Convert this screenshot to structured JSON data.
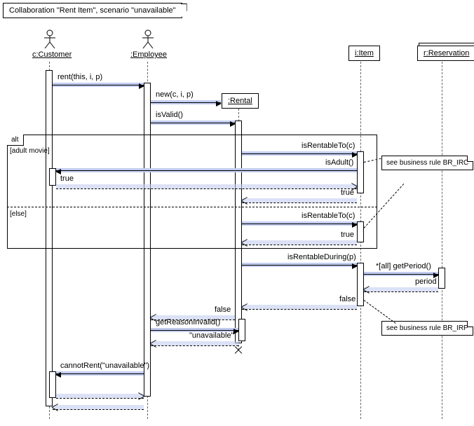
{
  "frame": {
    "title": "Collaboration \"Rent Item\", scenario \"unavailable\""
  },
  "lifelines": {
    "customer": {
      "label": "c:Customer"
    },
    "employee": {
      "label": ":Employee"
    },
    "rental": {
      "label": ":Rental"
    },
    "item": {
      "label": "i:Item"
    },
    "reservation": {
      "label": "r:Reservation"
    }
  },
  "alt": {
    "label": "alt",
    "guard1": "[adult movie]",
    "guard2": "[else]"
  },
  "messages": {
    "rent": "rent(this, i, p)",
    "new": "new(c, i, p)",
    "isValid": "isValid()",
    "isRentableTo1": "isRentableTo(c)",
    "isAdult": "isAdult()",
    "true1": "true",
    "true2": "true",
    "isRentableTo2": "isRentableTo(c)",
    "true3": "true",
    "isRentableDuring": "isRentableDuring(p)",
    "getPeriod": "*[all] getPeriod()",
    "period": "period",
    "false1": "false",
    "false2": "false",
    "getReasonInvalid": "getReasonInvalid()",
    "unavailable": "\"unavailable\"",
    "cannotRent": "cannotRent(\"unavailable\")"
  },
  "notes": {
    "br_irc": "see business rule BR_IRC",
    "br_irp": "see business rule BR_IRP"
  }
}
